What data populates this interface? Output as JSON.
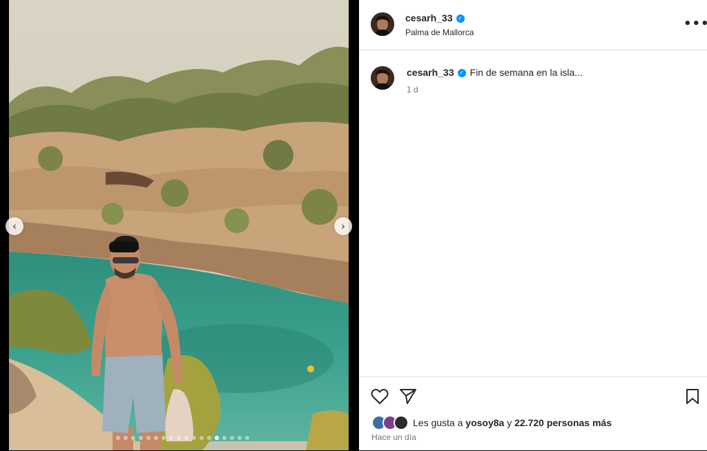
{
  "post": {
    "username": "cesarh_33",
    "location": "Palma de Mallorca",
    "caption": "Fin de semana en la isla...",
    "caption_time": "1 d",
    "more_label": "•••"
  },
  "media": {
    "prev_label": "‹",
    "next_label": "›",
    "slide_count": 18,
    "active_slide": 13
  },
  "likes": {
    "prefix": "Les gusta a",
    "user": "yosoy8a",
    "connector": "y",
    "count": "22.720 personas más"
  },
  "timestamp": "Hace un día",
  "icons": {
    "verified": "verified-badge-icon",
    "like": "heart-icon",
    "share": "send-icon",
    "save": "bookmark-icon"
  },
  "colors": {
    "verified": "#0095f6",
    "text": "#262626",
    "muted": "#737373",
    "divider": "#dbdbdb"
  }
}
